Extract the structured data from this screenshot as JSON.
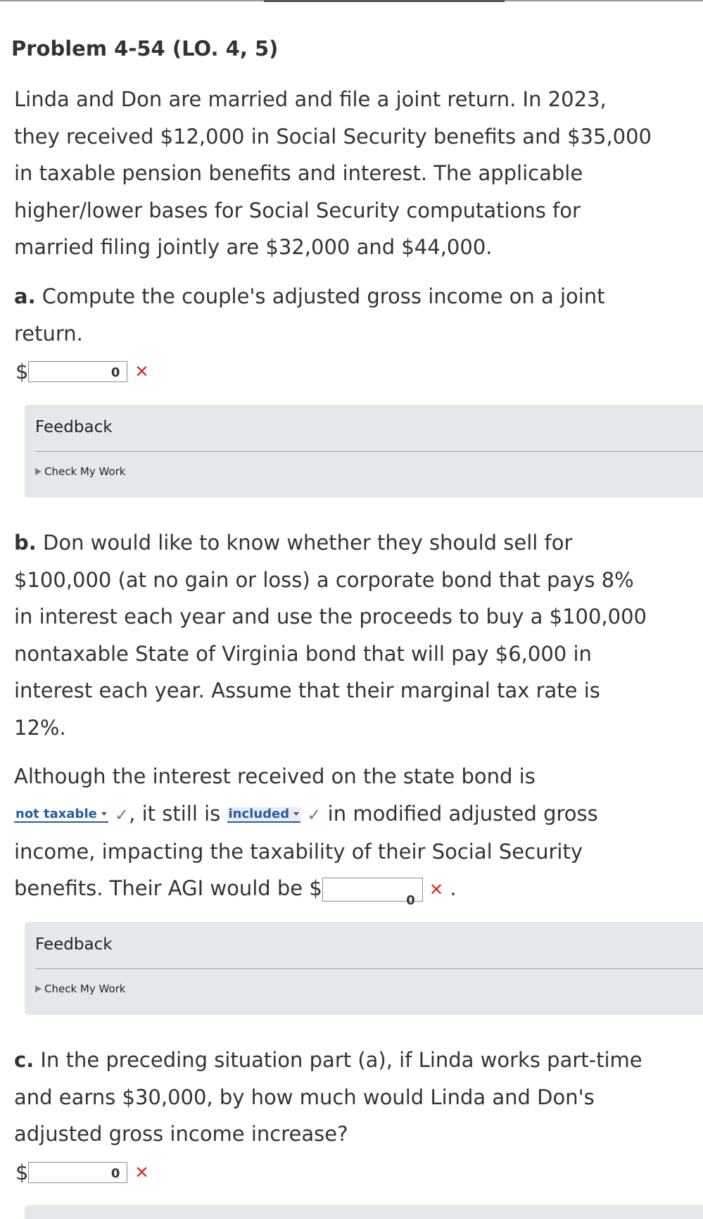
{
  "problem": {
    "title": "Problem 4-54 (LO. 4, 5)",
    "intro_lines": [
      "Linda and Don are married and file a joint return. In 2023,",
      "they received $12,000 in Social Security benefits and $35,000",
      "in taxable pension benefits and interest. The applicable",
      "higher/lower bases for Social Security computations for",
      "married filing jointly are $32,000 and $44,000."
    ]
  },
  "part_a": {
    "letter": "a.",
    "question_lines": [
      " Compute the couple's adjusted gross income on a joint",
      "return."
    ],
    "currency": "$",
    "answer_value": "0",
    "status_mark": "✕",
    "feedback": {
      "title": "Feedback",
      "check_label": "Check My Work"
    }
  },
  "part_b": {
    "letter": "b.",
    "question_lines": [
      " Don would like to know whether they should sell for",
      "$100,000 (at no gain or loss) a corporate bond that pays 8%",
      "in interest each year and use the proceeds to buy a $100,000",
      "nontaxable State of Virginia bond that will pay $6,000 in",
      "interest each year. Assume that their marginal tax rate is",
      "12%."
    ],
    "sentence": {
      "line1": "Although the interest received on the state bond is",
      "dropdown1_value": "not taxable",
      "dropdown1_status": "✓",
      "text_between": ", it still is",
      "dropdown2_value": "included",
      "dropdown2_status": "✓",
      "text_after_dropdown2": "in modified adjusted gross",
      "line3": "income, impacting the taxability of their Social Security",
      "line4_prefix": "benefits. Their AGI would be $",
      "answer_value": "0",
      "answer_status": "✕",
      "line4_suffix": "."
    },
    "feedback": {
      "title": "Feedback",
      "check_label": "Check My Work"
    }
  },
  "part_c": {
    "letter": "c.",
    "question_lines": [
      " In the preceding situation part (a), if Linda works part-time",
      "and earns $30,000, by how much would Linda and Don's",
      "adjusted gross income increase?"
    ],
    "currency": "$",
    "answer_value": "0",
    "status_mark": "✕"
  },
  "colors": {
    "error": "#e0271b",
    "correct": "#4e9a43",
    "dropdown_text": "#2a5aa0",
    "feedback_bg": "#e4e8eb"
  },
  "icons": {
    "incorrect": "x-mark-icon",
    "correct": "check-mark-icon",
    "expand": "triangle-right-icon",
    "dropdown": "chevron-down-icon"
  }
}
